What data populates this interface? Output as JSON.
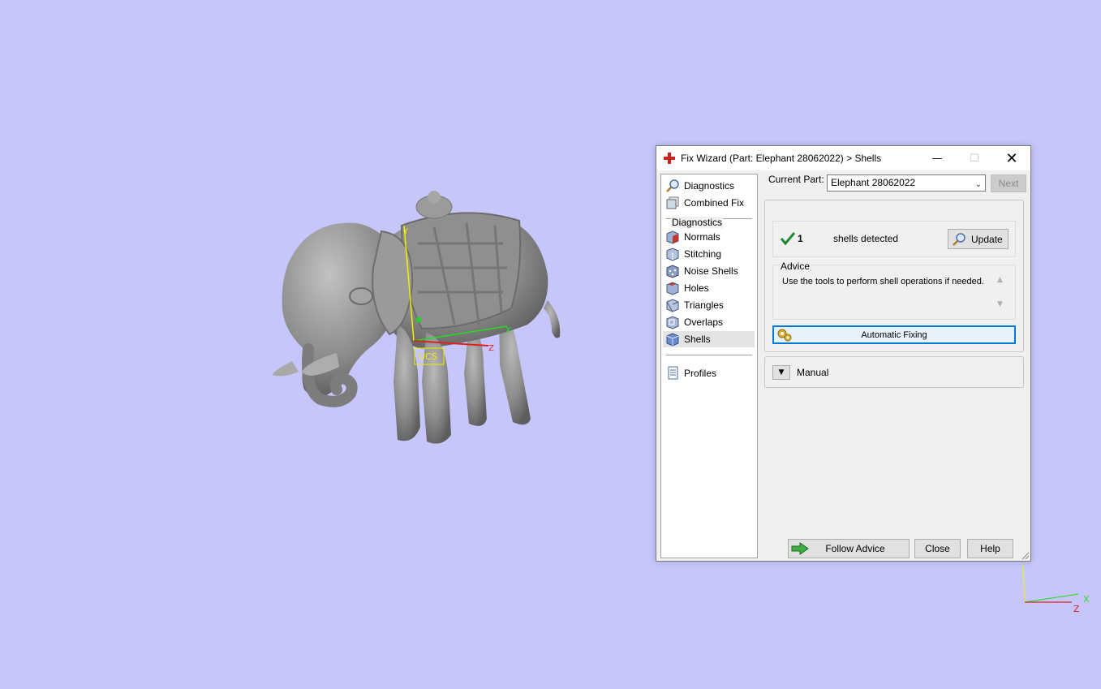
{
  "window": {
    "title": "Fix Wizard (Part: Elephant 28062022) > Shells",
    "minimize": "—",
    "maximize": "☐",
    "close": "✕"
  },
  "nav": {
    "items": [
      {
        "label": "Diagnostics",
        "icon": "magnifier-icon"
      },
      {
        "label": "Combined Fix",
        "icon": "combined-fix-icon"
      },
      {
        "label": "Normals",
        "icon": "normals-cube-icon"
      },
      {
        "label": "Stitching",
        "icon": "stitching-cube-icon"
      },
      {
        "label": "Noise Shells",
        "icon": "noise-shells-cube-icon"
      },
      {
        "label": "Holes",
        "icon": "holes-cube-icon"
      },
      {
        "label": "Triangles",
        "icon": "triangles-cube-icon"
      },
      {
        "label": "Overlaps",
        "icon": "overlaps-cube-icon"
      },
      {
        "label": "Shells",
        "icon": "shells-cube-icon",
        "selected": true
      },
      {
        "label": "Profiles",
        "icon": "document-icon"
      }
    ]
  },
  "current_part": {
    "label": "Current Part:",
    "value": "Elephant 28062022",
    "next_label": "Next"
  },
  "diagnostics": {
    "title": "Diagnostics",
    "count": "1",
    "text": "shells detected",
    "update_label": "Update"
  },
  "advice": {
    "title": "Advice",
    "text": "Use the tools to perform shell operations if needed."
  },
  "automatic_fixing_label": "Automatic Fixing",
  "manual_label": "Manual",
  "buttons": {
    "follow_advice": "Follow Advice",
    "close": "Close",
    "help": "Help"
  },
  "viewport": {
    "background": "#c6c6fb",
    "axis_labels": {
      "x": "X",
      "z": "Z",
      "ucs": "UCS"
    }
  }
}
